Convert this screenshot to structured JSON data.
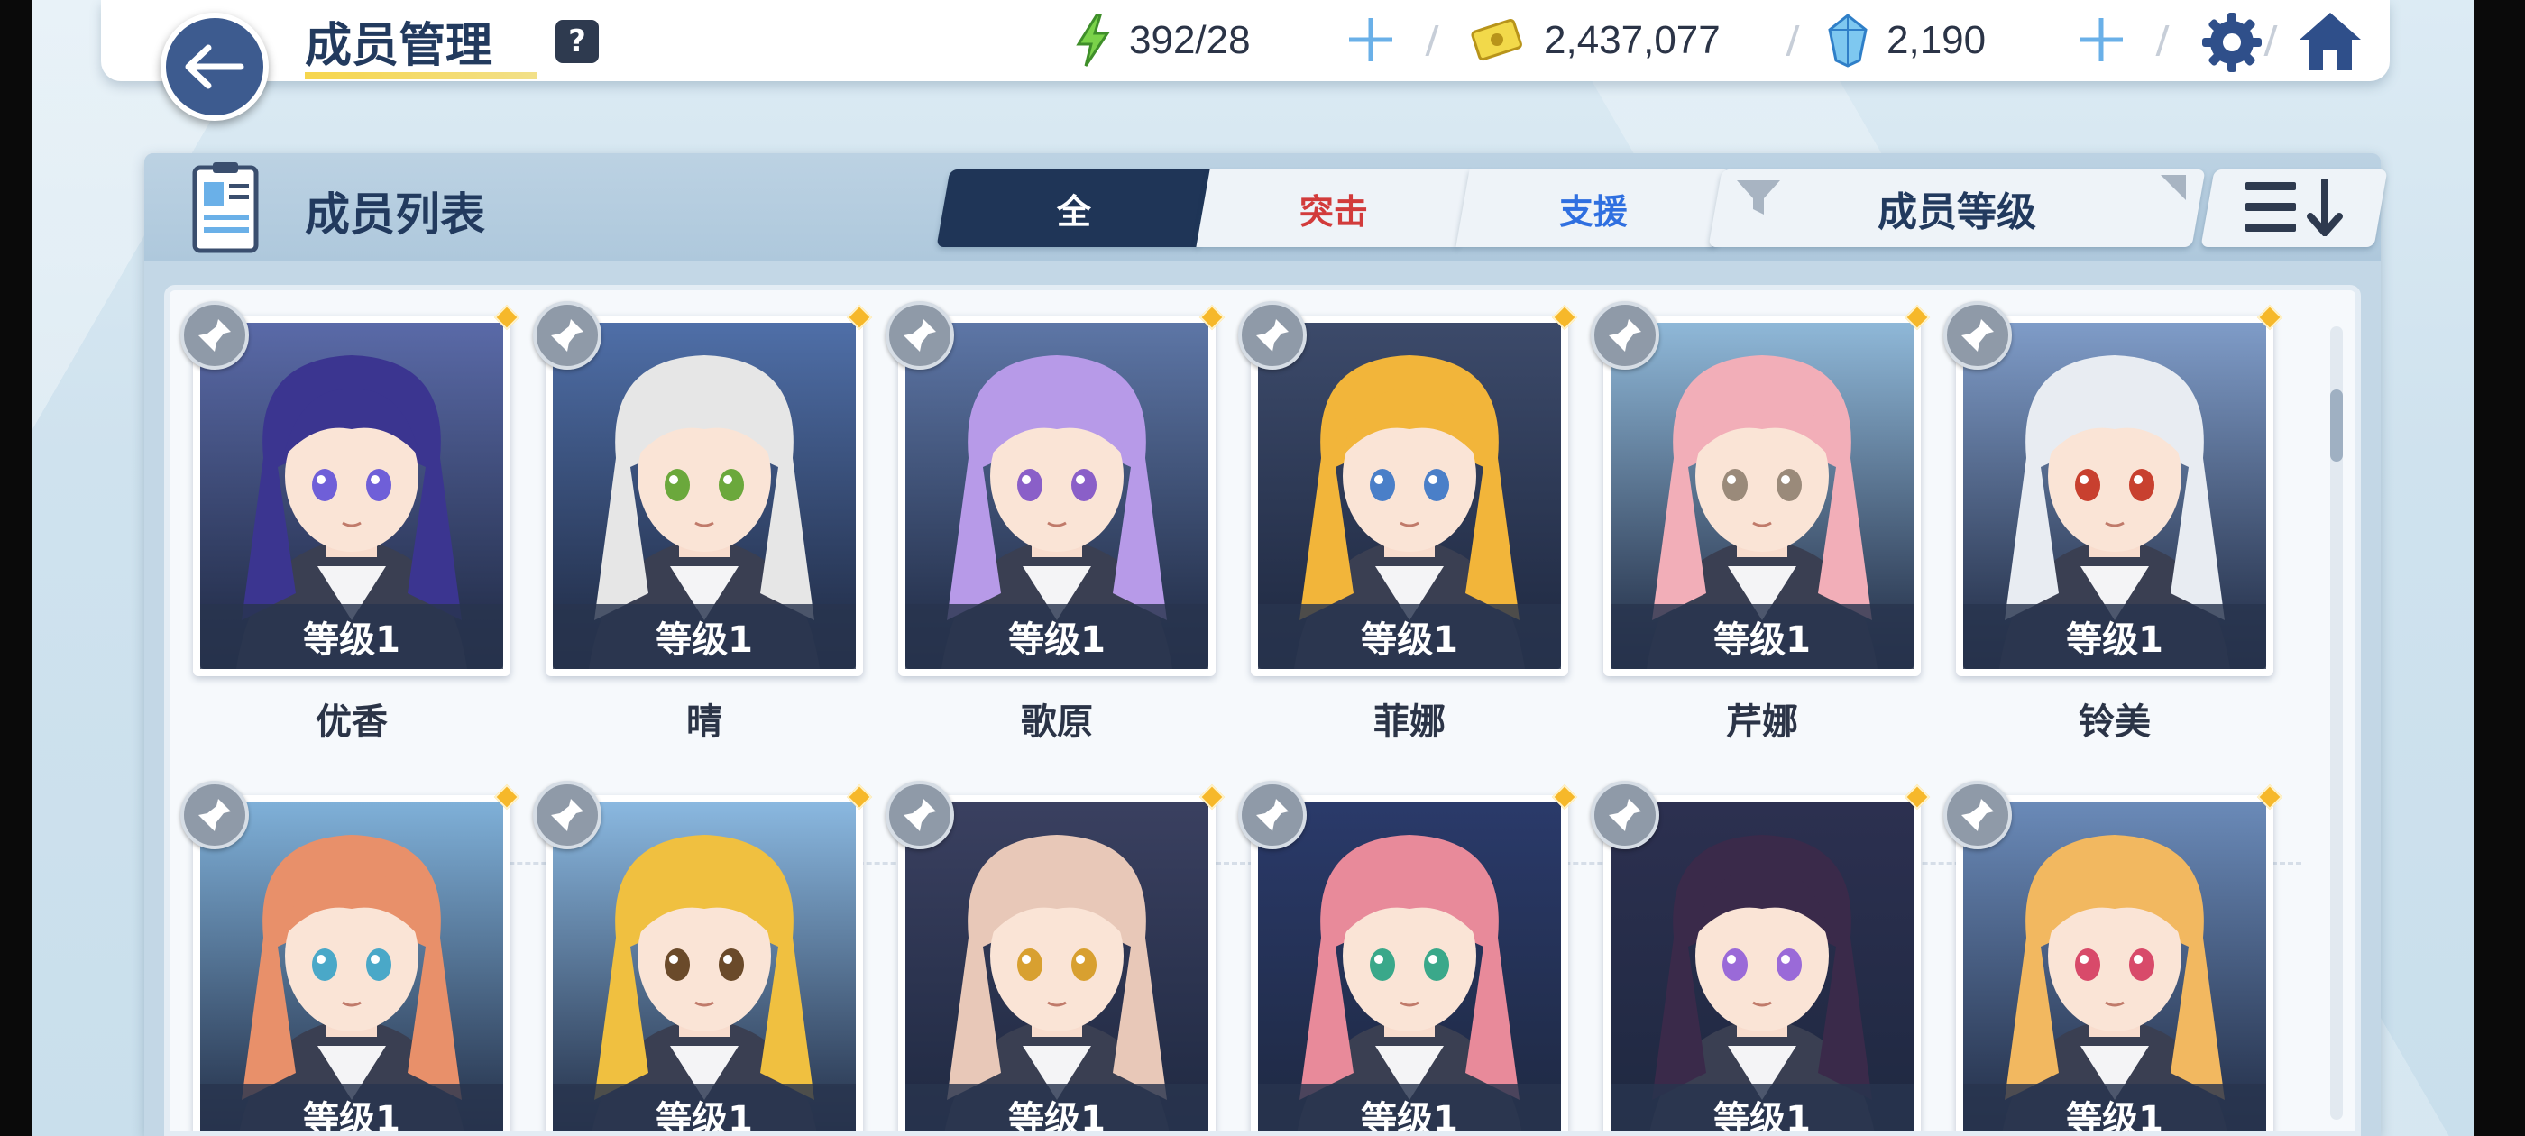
{
  "header": {
    "title": "成员管理",
    "help_label": "?",
    "stamina": "392/28",
    "credits": "2,437,077",
    "gems": "2,190"
  },
  "panel": {
    "title": "成员列表",
    "tabs": [
      {
        "label": "全",
        "active": true,
        "color": "#ffffff"
      },
      {
        "label": "突击",
        "active": false,
        "color": "#d23b3b"
      },
      {
        "label": "支援",
        "active": false,
        "color": "#2f6fe0"
      }
    ],
    "sort_label": "成员等级"
  },
  "members": [
    {
      "name": "优香",
      "level": "等级1",
      "hair": "#3b3590",
      "bg": "#5a6aa8",
      "eye": "#6f5fd8"
    },
    {
      "name": "晴",
      "level": "等级1",
      "hair": "#e6e6e6",
      "bg": "#4f6fa8",
      "eye": "#6ba83c"
    },
    {
      "name": "歌原",
      "level": "等级1",
      "hair": "#b79ae8",
      "bg": "#5d76a6",
      "eye": "#8a5fc8"
    },
    {
      "name": "菲娜",
      "level": "等级1",
      "hair": "#f2b53a",
      "bg": "#3c4a6a",
      "eye": "#4a7fc8"
    },
    {
      "name": "芹娜",
      "level": "等级1",
      "hair": "#f2aeb8",
      "bg": "#8fb8d8",
      "eye": "#9a8a7a"
    },
    {
      "name": "铃美",
      "level": "等级1",
      "hair": "#e8ecf2",
      "bg": "#7f9cc8",
      "eye": "#c8402f"
    },
    {
      "name": "",
      "level": "等级1",
      "hair": "#e8906a",
      "bg": "#7fb0d8",
      "eye": "#4aa8c8"
    },
    {
      "name": "",
      "level": "等级1",
      "hair": "#f0c040",
      "bg": "#8ab8e0",
      "eye": "#6a4a2a"
    },
    {
      "name": "",
      "level": "等级1",
      "hair": "#e8c8b8",
      "bg": "#3a4060",
      "eye": "#d8a030"
    },
    {
      "name": "",
      "level": "等级1",
      "hair": "#e88a9a",
      "bg": "#2a3a6a",
      "eye": "#3aa88a"
    },
    {
      "name": "",
      "level": "等级1",
      "hair": "#3a2a4a",
      "bg": "#2c3050",
      "eye": "#9a6ad8"
    },
    {
      "name": "",
      "level": "等级1",
      "hair": "#f2b860",
      "bg": "#6a8ab8",
      "eye": "#d84a6a"
    }
  ]
}
